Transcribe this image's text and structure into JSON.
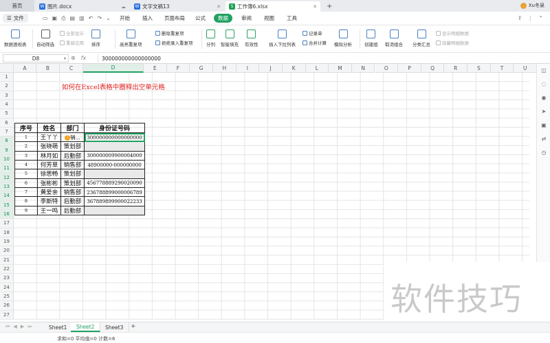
{
  "tabs": {
    "home": "首页",
    "items": [
      {
        "name": "图片.docx",
        "kind": "w"
      },
      {
        "name": "文字文稿13",
        "kind": "w"
      },
      {
        "name": "工作簿6.xlsx",
        "kind": "x"
      }
    ],
    "user": "Xu冬泉"
  },
  "menu": {
    "file": "文件",
    "items": [
      "开始",
      "插入",
      "页面布局",
      "公式",
      "数据",
      "审阅",
      "视图",
      "工具"
    ],
    "active": "数据"
  },
  "ribbon": {
    "pivot": "数据透视表",
    "autofilter": "自动筛选",
    "show_all": "全部显示",
    "reapply": "重新应用",
    "sort": "排序",
    "highlight_dup": "高亮重复项",
    "remove_dup": "删除重复项",
    "reject_dup": "拒绝录入重复项",
    "split": "分列",
    "smart_fill": "智能填充",
    "validation": "有效性",
    "insert_dropdown": "插入下拉列表",
    "record": "记录单",
    "consolidate": "合并计算",
    "simulate": "模拟分析",
    "group": "创建组",
    "ungroup": "取消组合",
    "subtotal": "分类汇总",
    "show_detail": "显示明细数据",
    "hide_detail": "隐藏明细数据"
  },
  "formula_bar": {
    "name_box": "D8",
    "fx": "fx",
    "value": "300000000000000000"
  },
  "columns": [
    "A",
    "B",
    "C",
    "D",
    "E",
    "F",
    "G",
    "H",
    "I",
    "J",
    "K",
    "L",
    "M",
    "N",
    "O",
    "P",
    "Q",
    "R",
    "S",
    "T",
    "U"
  ],
  "rows": [
    "1",
    "2",
    "3",
    "4",
    "5",
    "6",
    "7",
    "8",
    "9",
    "10",
    "11",
    "12",
    "13",
    "14",
    "15",
    "16",
    "17",
    "18",
    "19",
    "20",
    "21",
    "22",
    "23",
    "24",
    "25",
    "26",
    "27"
  ],
  "sheet": {
    "title": "如何在Excel表格中圈释出空单元格",
    "headers": [
      "序号",
      "姓名",
      "部门",
      "身份证号码"
    ],
    "rows": [
      {
        "no": "1",
        "name": "王丫丫",
        "dept": "销...",
        "id": "300000000000000000"
      },
      {
        "no": "2",
        "name": "张晓萌",
        "dept": "策划部",
        "id": ""
      },
      {
        "no": "3",
        "name": "林月如",
        "dept": "后勤部",
        "id": "300000009900004000"
      },
      {
        "no": "4",
        "name": "何芳草",
        "dept": "销售部",
        "id": "48900000-000000000"
      },
      {
        "no": "5",
        "name": "徐思畅",
        "dept": "策划部",
        "id": ""
      },
      {
        "no": "6",
        "name": "张彬彬",
        "dept": "策划部",
        "id": "456778889290020090"
      },
      {
        "no": "7",
        "name": "黄爱亲",
        "dept": "销售部",
        "id": "236788899000006789"
      },
      {
        "no": "8",
        "name": "李斯特",
        "dept": "后勤部",
        "id": "367889899900022233"
      },
      {
        "no": "9",
        "name": "王一鸣",
        "dept": "后勤部",
        "id": ""
      }
    ]
  },
  "sheet_tabs": [
    "Sheet1",
    "Sheet2",
    "Sheet3"
  ],
  "active_sheet": "Sheet2",
  "status": "求和=0  平均值=0  计数=6",
  "watermark": "软件技巧"
}
